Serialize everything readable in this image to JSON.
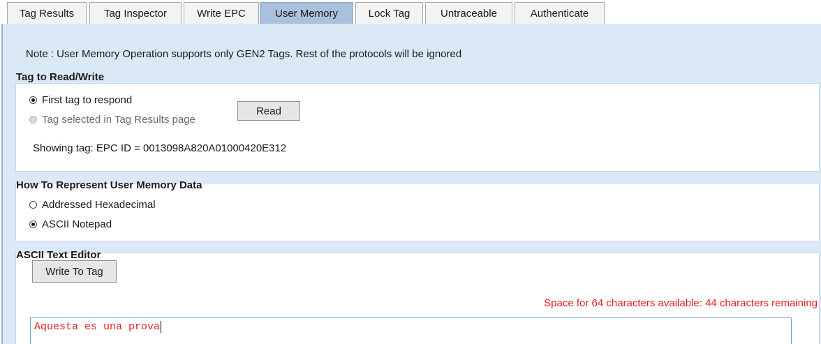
{
  "tabs": [
    {
      "label": "Tag Results",
      "active": false
    },
    {
      "label": "Tag Inspector",
      "active": false
    },
    {
      "label": "Write EPC",
      "active": false
    },
    {
      "label": "User Memory",
      "active": true
    },
    {
      "label": "Lock Tag",
      "active": false
    },
    {
      "label": "Untraceable",
      "active": false
    },
    {
      "label": "Authenticate",
      "active": false
    }
  ],
  "note": "Note : User Memory Operation supports only GEN2 Tags. Rest of the protocols will be ignored",
  "tag_group": {
    "title": "Tag to Read/Write",
    "options": [
      {
        "label": "First tag to respond",
        "selected": true,
        "enabled": true
      },
      {
        "label": "Tag selected in Tag Results page",
        "selected": false,
        "enabled": false
      }
    ],
    "read_button": "Read",
    "showing_tag": "Showing tag: EPC ID = 0013098A820A01000420E312"
  },
  "represent_group": {
    "title": "How To Represent User Memory Data",
    "options": [
      {
        "label": "Addressed Hexadecimal",
        "selected": false
      },
      {
        "label": "ASCII Notepad",
        "selected": true
      }
    ]
  },
  "editor_group": {
    "title": "ASCII Text Editor",
    "write_button": "Write To Tag",
    "remaining": "Space for 64 characters available: 44 characters remaining",
    "text": "Aquesta es una prova"
  },
  "colors": {
    "panel_bg": "#dbe8f5",
    "active_tab": "#a9c1dd",
    "warning_text": "#e31d1d"
  }
}
